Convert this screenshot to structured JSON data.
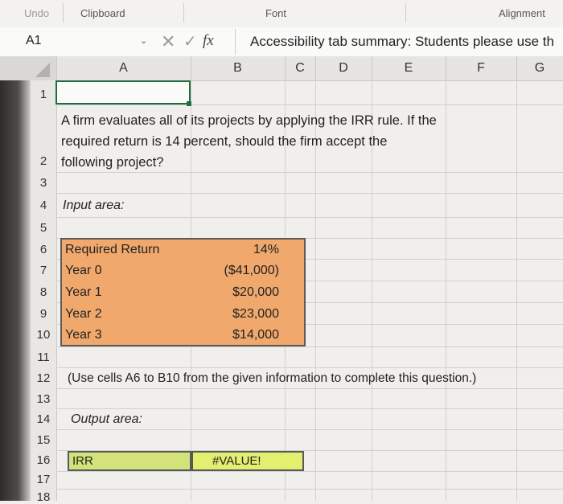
{
  "ribbon": {
    "groups": [
      "Undo",
      "Clipboard",
      "Font",
      "Alignment"
    ]
  },
  "formula_bar": {
    "name_box": "A1",
    "fx": "fx",
    "content": "Accessibility tab summary: Students please use th"
  },
  "columns": [
    "A",
    "B",
    "C",
    "D",
    "E",
    "F",
    "G"
  ],
  "rows": [
    "1",
    "2",
    "3",
    "4",
    "5",
    "6",
    "7",
    "8",
    "9",
    "10",
    "11",
    "12",
    "13",
    "14",
    "15",
    "16",
    "17",
    "18"
  ],
  "cells": {
    "A2": "A firm evaluates all of its projects by applying the IRR rule. If the required return is 14 percent, should the firm accept the following project?",
    "A4": "Input area:",
    "A6": "Required Return",
    "B6": "14%",
    "A7": "Year 0",
    "B7": "($41,000)",
    "A8": "Year 1",
    "B8": "$20,000",
    "A9": "Year 2",
    "B9": "$23,000",
    "A10": "Year 3",
    "B10": "$14,000",
    "A12": "(Use cells A6 to B10 from the given information to complete this question.)",
    "A14": "Output area:",
    "A16": "IRR",
    "B16": "#VALUE!"
  },
  "colors": {
    "input_fill": "#f0a86c",
    "output_label_fill": "#d4e27a",
    "output_value_fill": "#e3ef6f",
    "selection": "#1f6e43"
  }
}
